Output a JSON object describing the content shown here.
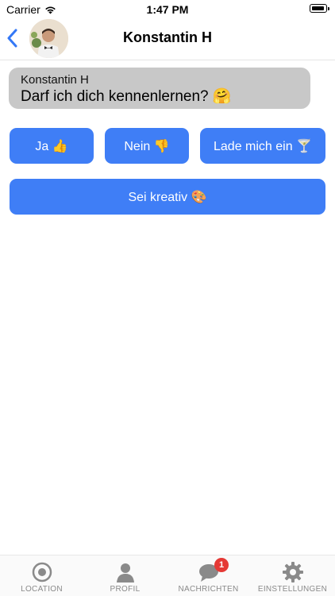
{
  "status_bar": {
    "carrier": "Carrier",
    "time": "1:47 PM"
  },
  "nav": {
    "title": "Konstantin H",
    "back_icon": "chevron-left-icon",
    "accent_color": "#3478f6"
  },
  "message": {
    "sender": "Konstantin H",
    "text": "Darf ich dich kennenlernen? 🤗"
  },
  "replies": {
    "ja": "Ja 👍",
    "nein": "Nein 👎",
    "lade": "Lade mich ein 🍸",
    "kreativ": "Sei kreativ 🎨",
    "button_color": "#3f7ef6"
  },
  "tab_bar": {
    "items": [
      {
        "label": "LOCATION",
        "icon": "location-icon"
      },
      {
        "label": "PROFIL",
        "icon": "profile-icon"
      },
      {
        "label": "NACHRICHTEN",
        "icon": "chat-icon",
        "badge": "1"
      },
      {
        "label": "EINSTELLUNGEN",
        "icon": "gear-icon"
      }
    ]
  }
}
